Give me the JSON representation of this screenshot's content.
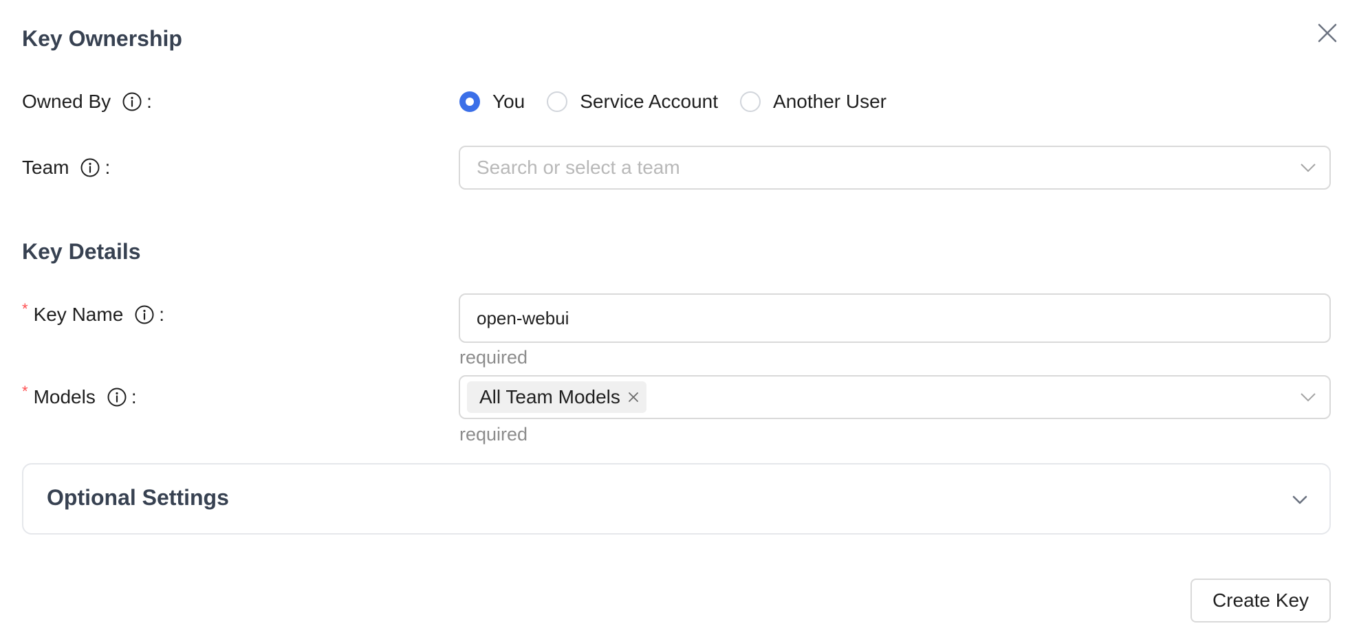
{
  "sections": {
    "ownership_title": "Key Ownership",
    "details_title": "Key Details"
  },
  "owned_by": {
    "label": "Owned By",
    "options": [
      "You",
      "Service Account",
      "Another User"
    ],
    "selected": "You"
  },
  "team": {
    "label": "Team",
    "placeholder": "Search or select a team"
  },
  "key_name": {
    "label": "Key Name",
    "value": "open-webui",
    "helper": "required"
  },
  "models": {
    "label": "Models",
    "tag": "All Team Models",
    "helper": "required"
  },
  "optional_settings": {
    "title": "Optional Settings"
  },
  "actions": {
    "create_label": "Create Key"
  },
  "colors": {
    "accent": "#3b6fe8",
    "required_mark": "#ff4d4f",
    "heading": "#374151",
    "helper": "#8c8c8c"
  },
  "punctuation": {
    "colon": ":",
    "required_mark": "*"
  }
}
